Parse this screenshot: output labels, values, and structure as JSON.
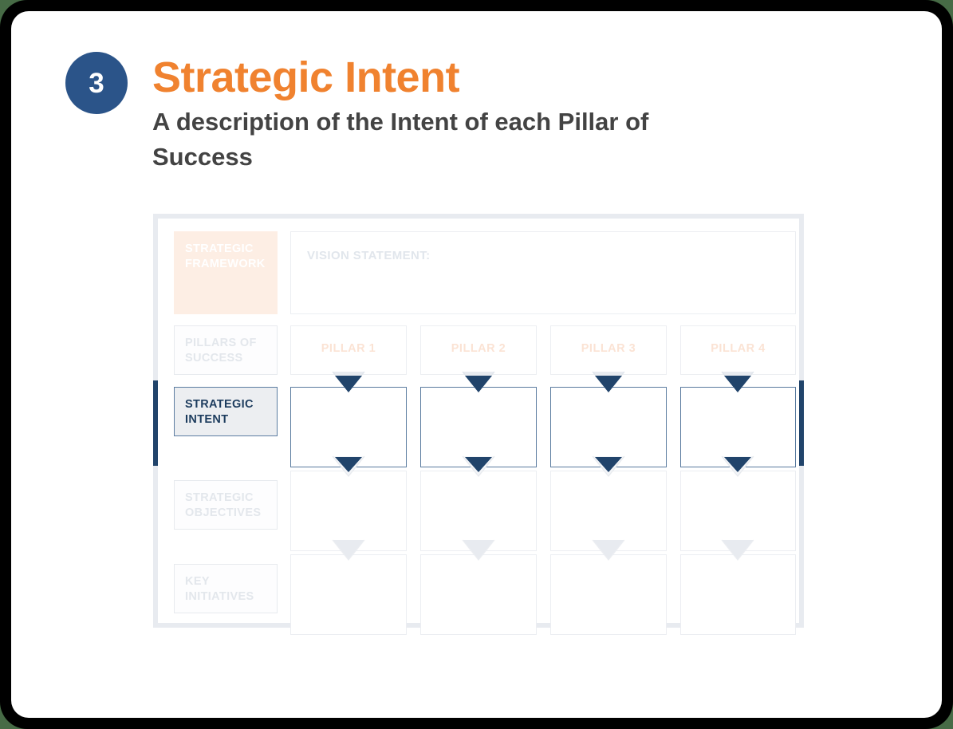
{
  "slide": {
    "step_number": "3",
    "title": "Strategic Intent",
    "subtitle": "A description of the Intent of each Pillar of Success",
    "accent_color": "#f0822f",
    "badge_color": "#2b5489",
    "active_color": "#21446b",
    "background_color": "#476b46"
  },
  "diagram": {
    "rows": [
      {
        "label": "STRATEGIC FRAMEWORK",
        "state": "framework"
      },
      {
        "label": "PILLARS OF SUCCESS",
        "state": "muted"
      },
      {
        "label": "STRATEGIC INTENT",
        "state": "active"
      },
      {
        "label": "STRATEGIC OBJECTIVES",
        "state": "muted"
      },
      {
        "label": "KEY INITIATIVES",
        "state": "muted"
      }
    ],
    "vision": {
      "label": "VISION STATEMENT:"
    },
    "pillars": [
      {
        "label": "PILLAR 1"
      },
      {
        "label": "PILLAR 2"
      },
      {
        "label": "PILLAR 3"
      },
      {
        "label": "PILLAR 4"
      }
    ],
    "intent_cells": [
      {
        "label": ""
      },
      {
        "label": ""
      },
      {
        "label": ""
      },
      {
        "label": ""
      }
    ],
    "objective_cells": [
      {
        "label": ""
      },
      {
        "label": ""
      },
      {
        "label": ""
      },
      {
        "label": ""
      }
    ],
    "initiative_cells": [
      {
        "label": ""
      },
      {
        "label": ""
      },
      {
        "label": ""
      },
      {
        "label": ""
      }
    ]
  }
}
